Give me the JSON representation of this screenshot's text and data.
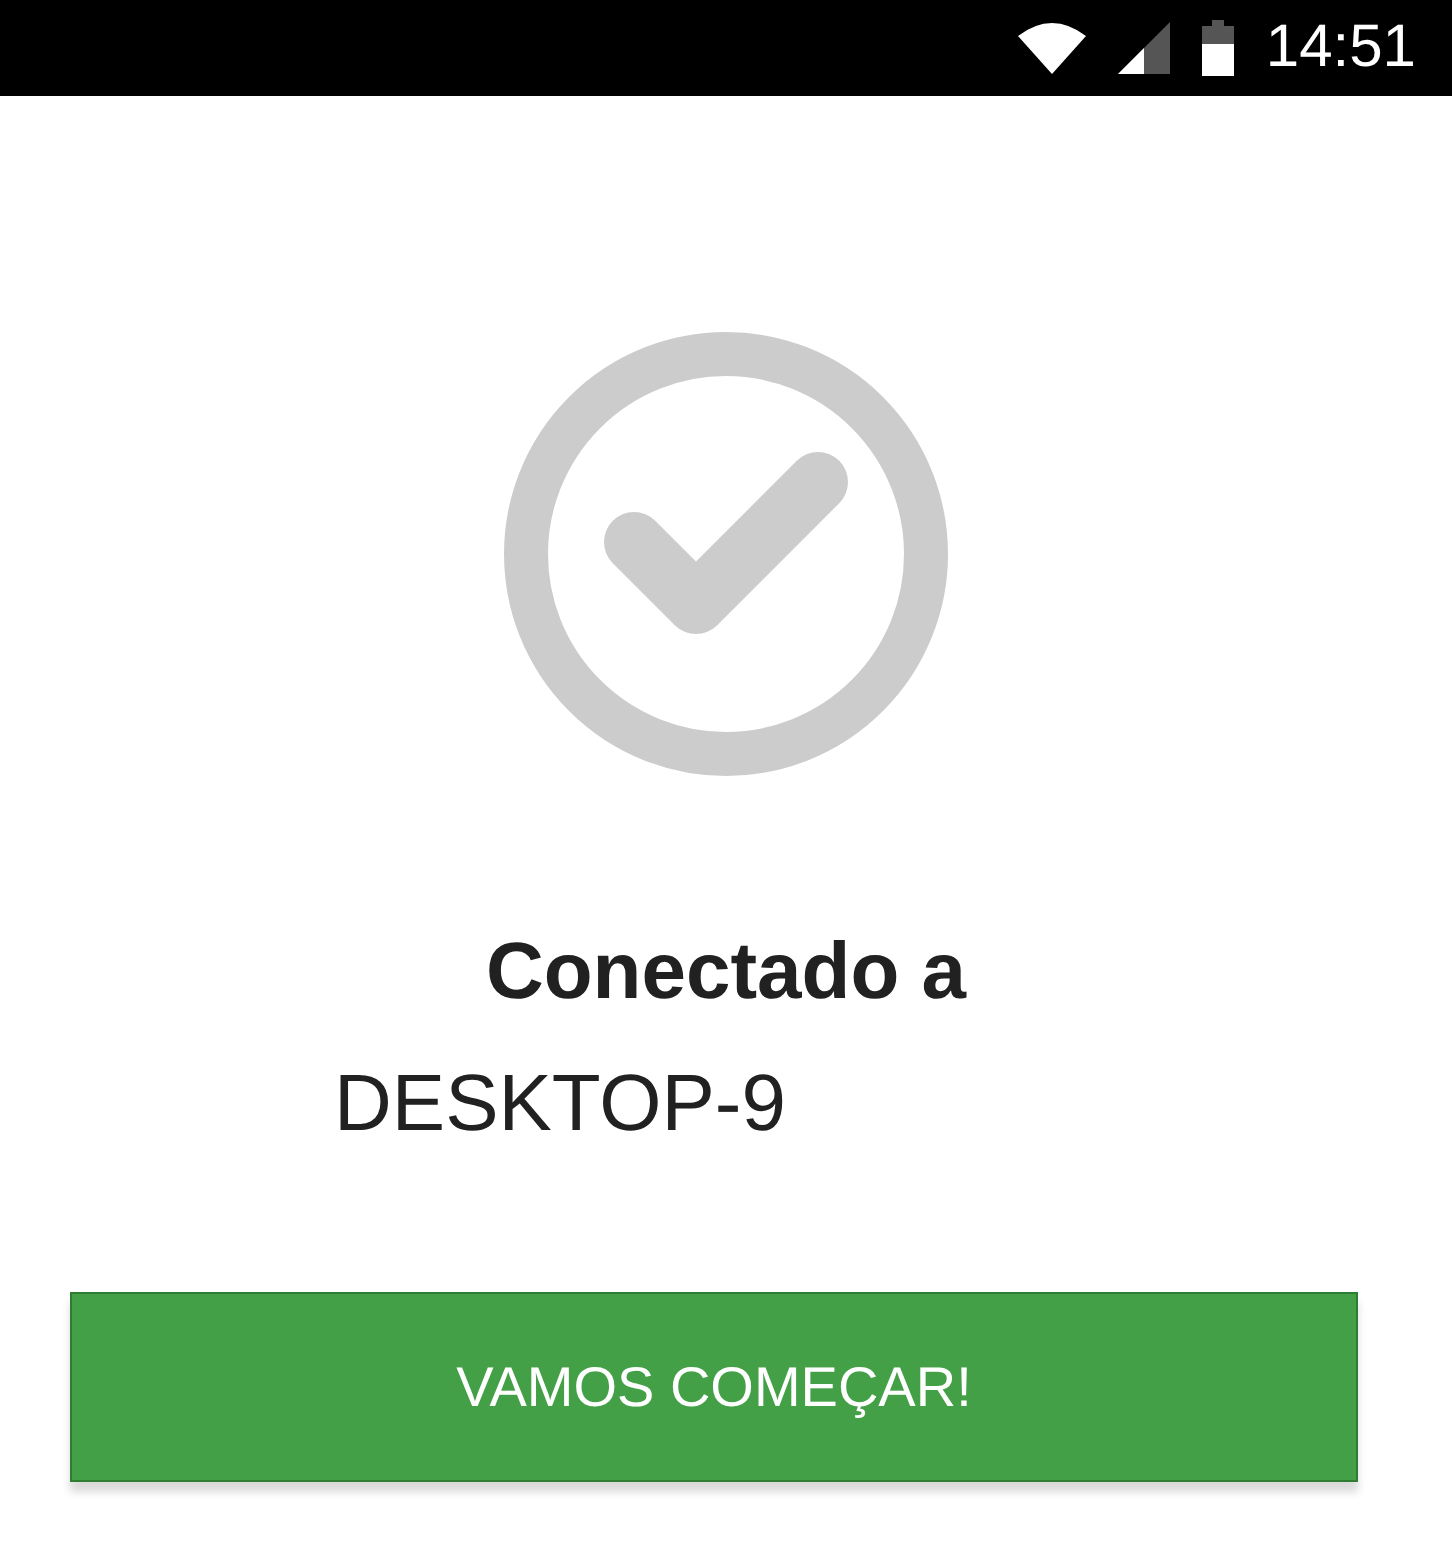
{
  "status_bar": {
    "time": "14:51"
  },
  "title": "Conectado a",
  "device_name": "DESKTOP-9",
  "button": {
    "label": "VAMOS COMEÇAR!"
  }
}
